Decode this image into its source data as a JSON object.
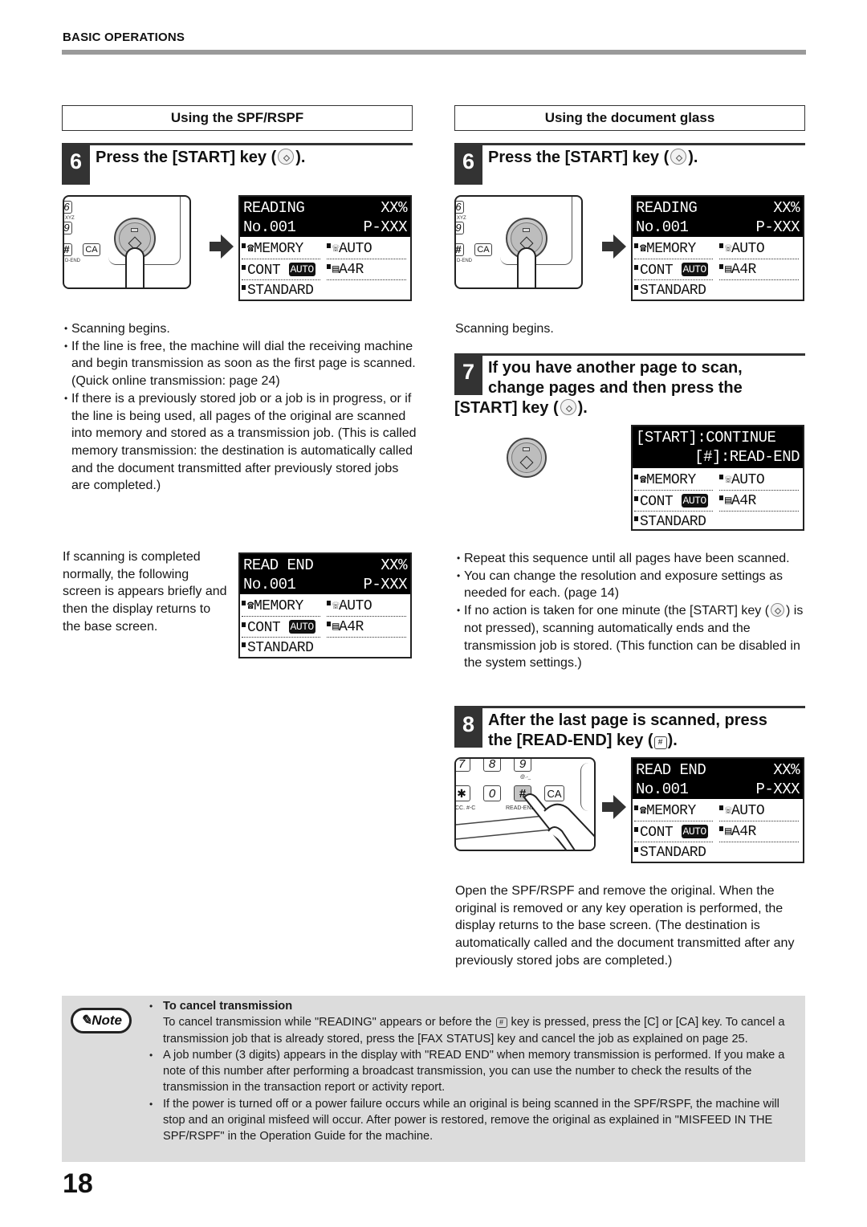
{
  "header": {
    "section": "BASIC OPERATIONS"
  },
  "left": {
    "column_title": "Using the SPF/RSPF",
    "step6": {
      "number": "6",
      "title_prefix": "Press the [START] key (",
      "title_suffix": ")."
    },
    "panel": {
      "key6": "6",
      "key9": "9",
      "keyhash": "#",
      "keyca": "CA",
      "lbl_xyz": "XYZ",
      "lbl_dend": "D-END"
    },
    "lcd_reading": {
      "line1_left": "READING",
      "line1_right": "XX%",
      "line2_left": "No.001",
      "line2_right": "P-XXX",
      "memory": "MEMORY",
      "auto": "AUTO",
      "cont": "CONT",
      "cont_badge": "AUTO",
      "paper": "A4R",
      "resolution": "STANDARD"
    },
    "bullets": [
      "Scanning begins.",
      "If the line is free, the machine will dial the receiving machine and begin transmission as soon as the first page is scanned. (Quick online transmission: page 24)",
      "If there is a previously stored job or a job is in progress, or if the line is being used, all pages of the original are scanned into memory and stored as a transmission job. (This is called memory transmission: the destination is automatically called and the document transmitted after previously stored jobs are completed.)"
    ],
    "completed_text": "If scanning is completed normally, the following screen is appears briefly and then the display returns to the base screen.",
    "lcd_readend": {
      "line1_left": "READ END",
      "line1_right": "XX%",
      "line2_left": "No.001",
      "line2_right": "P-XXX",
      "memory": "MEMORY",
      "auto": "AUTO",
      "cont": "CONT",
      "cont_badge": "AUTO",
      "paper": "A4R",
      "resolution": "STANDARD"
    }
  },
  "right": {
    "column_title": "Using the document glass",
    "step6": {
      "number": "6",
      "title_prefix": "Press the [START] key (",
      "title_suffix": ")."
    },
    "panel": {
      "key6": "6",
      "key9": "9",
      "keyhash": "#",
      "keyca": "CA",
      "lbl_xyz": "XYZ",
      "lbl_dend": "D-END"
    },
    "lcd_reading": {
      "line1_left": "READING",
      "line1_right": "XX%",
      "line2_left": "No.001",
      "line2_right": "P-XXX",
      "memory": "MEMORY",
      "auto": "AUTO",
      "cont": "CONT",
      "cont_badge": "AUTO",
      "paper": "A4R",
      "resolution": "STANDARD"
    },
    "scanning_begins": "Scanning begins.",
    "step7": {
      "number": "7",
      "title_line1": "If you have another page to scan,",
      "title_line2": "change pages and then press the",
      "title_line3_prefix": "[START] key (",
      "title_line3_suffix": ")."
    },
    "lcd_continue": {
      "line1": "[START]:CONTINUE",
      "line2": "[#]:READ-END",
      "memory": "MEMORY",
      "auto": "AUTO",
      "cont": "CONT",
      "cont_badge": "AUTO",
      "paper": "A4R",
      "resolution": "STANDARD"
    },
    "bullets7": [
      "Repeat this sequence until all pages have been scanned.",
      "You can change the resolution and exposure settings as needed for each. (page 14)"
    ],
    "bullet7_last_prefix": "If no action is taken for one minute (the [START] key (",
    "bullet7_last_suffix": ") is not pressed), scanning automatically ends and the transmission job is stored. (This function can be disabled in the system settings.)",
    "step8": {
      "number": "8",
      "title_line1": "After the last page is scanned, press",
      "title_line2_prefix": "the [READ-END] key (",
      "title_line2_suffix": ")."
    },
    "keypad": {
      "k7": "7",
      "k8": "8",
      "k9": "9",
      "kstar": "✱",
      "k0": "0",
      "khash": "#",
      "kca": "CA",
      "lbl_acc": "CC. #-C",
      "lbl_readend": "READ-END",
      "lbl_at": "@.-_"
    },
    "lcd_readend": {
      "line1_left": "READ END",
      "line1_right": "XX%",
      "line2_left": "No.001",
      "line2_right": "P-XXX",
      "memory": "MEMORY",
      "auto": "AUTO",
      "cont": "CONT",
      "cont_badge": "AUTO",
      "paper": "A4R",
      "resolution": "STANDARD"
    },
    "final_text": "Open the SPF/RSPF and remove the original. When the original is removed or any key operation is performed, the display returns to the base screen. (The destination is automatically called and the document transmitted after any previously stored jobs are completed.)"
  },
  "note": {
    "badge": "Note",
    "subhead": "To cancel transmission",
    "item1_prefix": "To cancel transmission while \"READING\" appears or before the ",
    "item1_suffix": " key is pressed, press the [C] or [CA] key. To cancel a transmission job that is already stored, press the [FAX STATUS] key and cancel the job as explained on page 25.",
    "item2": "A job number (3 digits) appears in the display with \"READ END\" when memory transmission is performed. If you make a note of this number after performing a broadcast transmission, you can use the number to check the results of the transmission in the transaction report or activity report.",
    "item3": "If the power is turned off or a power failure occurs while an original is being scanned in the SPF/RSPF, the machine will stop and an original misfeed will occur. After power is restored, remove the original as explained in \"MISFEED IN THE SPF/RSPF\" in the Operation Guide for the machine."
  },
  "page_number": "18"
}
